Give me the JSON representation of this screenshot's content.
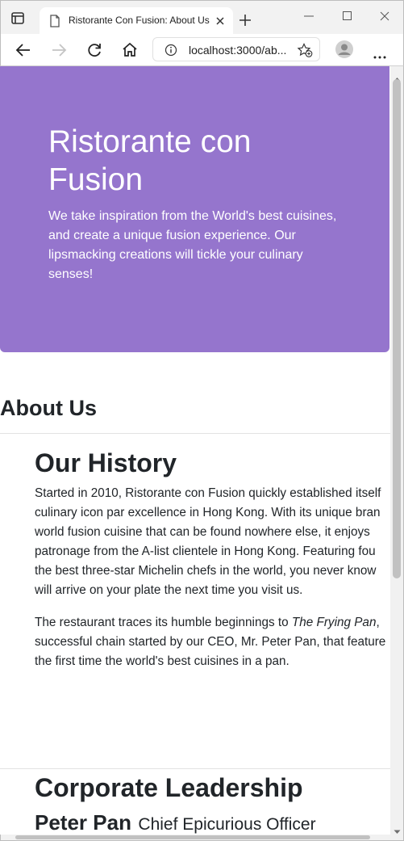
{
  "browser": {
    "tab_title": "Ristorante Con Fusion: About Us",
    "address": "localhost:3000/ab..."
  },
  "jumbotron": {
    "title": "Ristorante con Fusion",
    "text": "We take inspiration from the World's best cuisines, and create a unique fusion experience. Our lipsmacking creations will tickle your culinary senses!"
  },
  "about": {
    "heading": "About Us",
    "history_heading": "Our History",
    "history_lines": [
      "Started in 2010, Ristorante con Fusion quickly established itself",
      "culinary icon par excellence in Hong Kong. With its unique bran",
      "world fusion cuisine that can be found nowhere else, it enjoys",
      "patronage from the A-list clientele in Hong Kong. Featuring fou",
      "the best three-star Michelin chefs in the world, you never know",
      "will arrive on your plate the next time you visit us."
    ],
    "para2": {
      "line1_start": "The restaurant traces its humble beginnings to ",
      "line1_italic": "The Frying Pan",
      "line1_end": ",",
      "line2": "successful chain started by our CEO, Mr. Peter Pan, that feature",
      "line3": "the first time the world's best cuisines in a pan."
    },
    "leadership_heading": "Corporate Leadership",
    "leader_name": "Peter Pan",
    "leader_role": "Chief Epicurious Officer"
  },
  "colors": {
    "jumbotron_bg": "#9575cd",
    "text": "#212529"
  }
}
